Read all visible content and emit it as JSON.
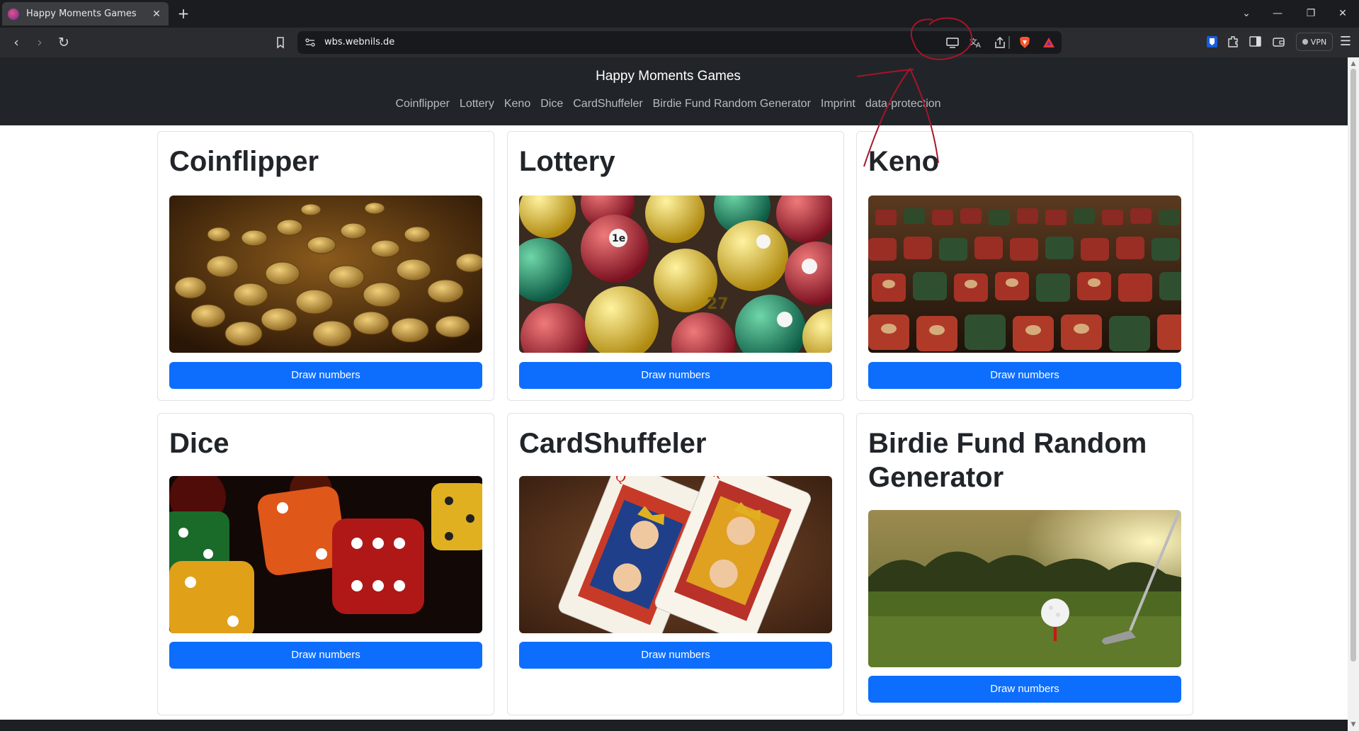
{
  "tab": {
    "title": "Happy Moments Games",
    "favicon": "brave-logo-icon"
  },
  "address_bar": {
    "url": "wbs.webnils.de"
  },
  "browser": {
    "vpn_label": "VPN"
  },
  "site": {
    "title": "Happy Moments Games",
    "nav": [
      {
        "label": "Coinflipper"
      },
      {
        "label": "Lottery"
      },
      {
        "label": "Keno"
      },
      {
        "label": "Dice"
      },
      {
        "label": "CardShuffeler"
      },
      {
        "label": "Birdie Fund Random Generator"
      },
      {
        "label": "Imprint"
      },
      {
        "label": "data-protection"
      }
    ]
  },
  "cards": [
    {
      "title": "Coinflipper",
      "image": "gold-coins-photo",
      "button": "Draw numbers"
    },
    {
      "title": "Lottery",
      "image": "lottery-balls-photo",
      "button": "Draw numbers"
    },
    {
      "title": "Keno",
      "image": "keno-dice-photo",
      "button": "Draw numbers"
    },
    {
      "title": "Dice",
      "image": "colorful-dice-photo",
      "button": "Draw numbers"
    },
    {
      "title": "CardShuffeler",
      "image": "playing-cards-photo",
      "button": "Draw numbers"
    },
    {
      "title": "Birdie Fund Random Generator",
      "image": "golf-ball-photo",
      "button": "Draw numbers"
    }
  ],
  "colors": {
    "primary": "#0d6efd",
    "header_bg": "#212529",
    "annotation": "#a8142a"
  }
}
